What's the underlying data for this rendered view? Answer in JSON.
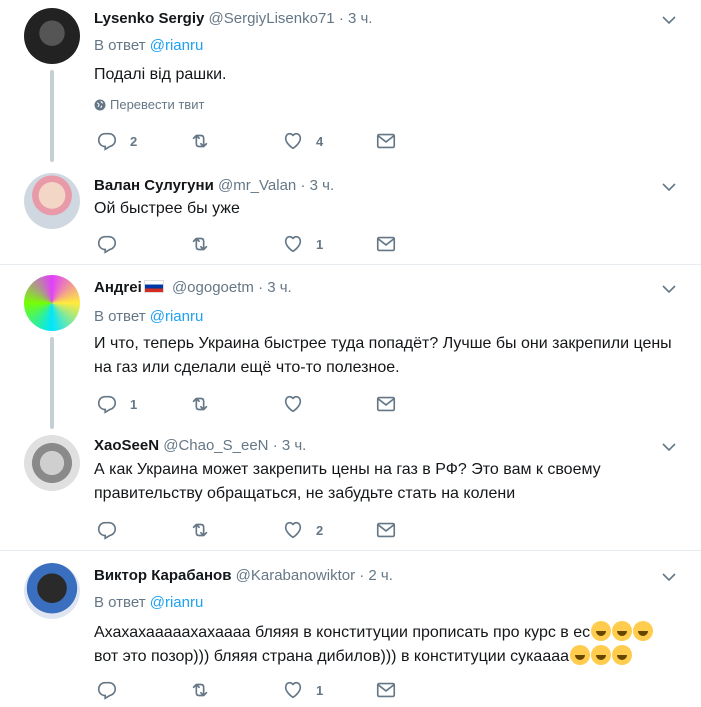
{
  "tweets": [
    {
      "name": "Lysenko Sergiy",
      "handle": "@SergiyLisenko71",
      "time": "3 ч.",
      "reply_prefix": "В ответ",
      "reply_to": "@rianru",
      "text": "Подалі від рашки.",
      "translate": "Перевести твит",
      "replies": "2",
      "retweets": "",
      "likes": "4"
    },
    {
      "name": "Валан Сулугуни",
      "handle": "@mr_Valan",
      "time": "3 ч.",
      "text": "Ой быстрее бы уже",
      "replies": "",
      "retweets": "",
      "likes": "1"
    },
    {
      "name": "Андrei",
      "handle": "@ogogoetm",
      "time": "3 ч.",
      "reply_prefix": "В ответ",
      "reply_to": "@rianru",
      "text_line1": "И что, теперь Украина быстрее туда попадёт? Лучше бы они закрепили цены",
      "text_line2": "на газ или сделали ещё что-то полезное.",
      "replies": "1",
      "retweets": "",
      "likes": ""
    },
    {
      "name": "XaoSeeN",
      "handle": "@Chao_S_eeN",
      "time": "3 ч.",
      "text_line1": "А как Украина может закрепить цены на газ в РФ? Это вам к своему",
      "text_line2": "правительству обращаться, не забудьте стать на колени",
      "replies": "",
      "retweets": "",
      "likes": "2"
    },
    {
      "name": "Виктор Карабанов",
      "handle": "@Karabanowiktor",
      "time": "2 ч.",
      "reply_prefix": "В ответ",
      "reply_to": "@rianru",
      "text_line1": "Ахахахааааахахаааа бляяя в конституции прописать про курс в ес",
      "text_line2": "вот это позор))) бляяя страна дибилов))) в конституции сукаааа",
      "replies": "",
      "retweets": "",
      "likes": "1"
    }
  ],
  "colors": {
    "link": "#1da1f2",
    "muted": "#657786",
    "thread": "#c4cfd6",
    "separator": "#e6ecf0"
  },
  "icons": [
    "reply-icon",
    "retweet-icon",
    "like-icon",
    "dm-icon",
    "chevron-down-icon",
    "globe-icon",
    "rofl-emoji"
  ]
}
